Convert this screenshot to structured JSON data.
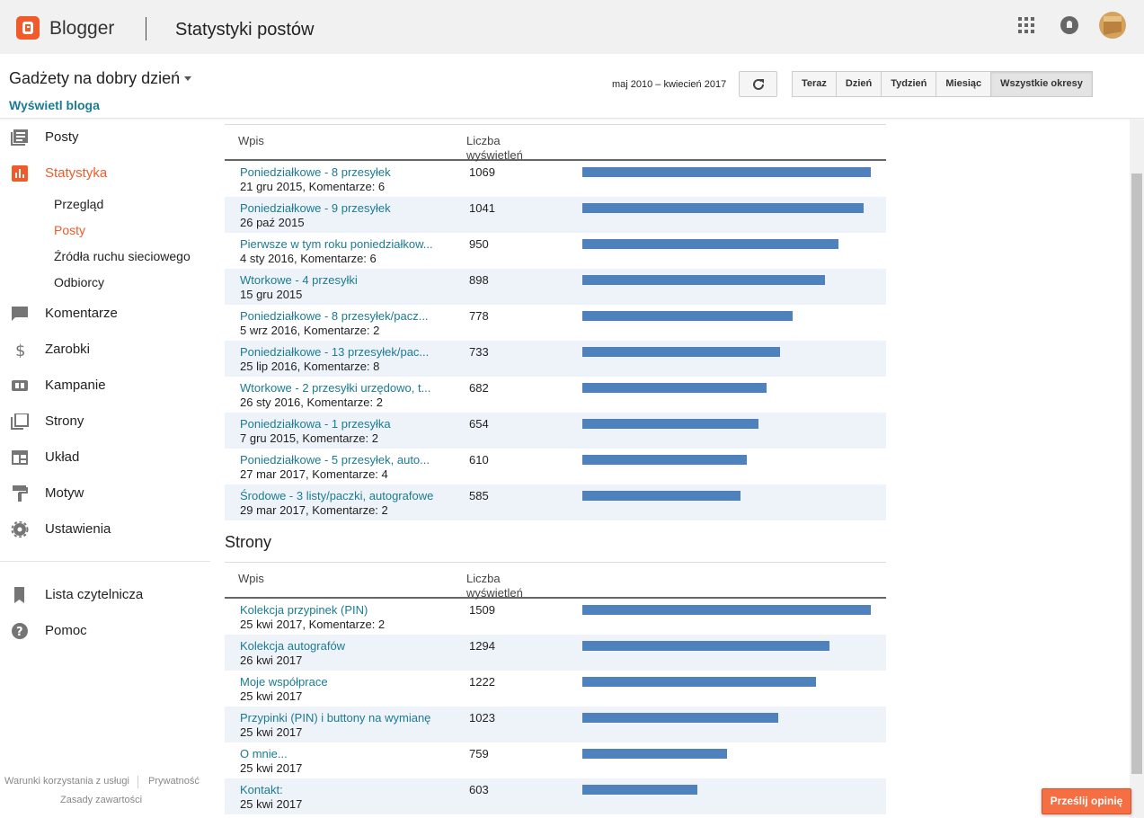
{
  "topbar": {
    "brand": "Blogger",
    "title": "Statystyki postów",
    "icons": [
      "apps-grid-icon",
      "notifications-bell-icon",
      "account-avatar"
    ]
  },
  "subheader": {
    "blog_name": "Gadżety na dobry dzień",
    "view_blog": "Wyświetl bloga",
    "date_range": "maj 2010 – kwiecień 2017",
    "periods": [
      "Teraz",
      "Dzień",
      "Tydzień",
      "Miesiąc",
      "Wszystkie okresy"
    ],
    "active_period": "Wszystkie okresy"
  },
  "sidebar": {
    "items": [
      {
        "label": "Posty",
        "icon": "posts-icon"
      },
      {
        "label": "Statystyka",
        "icon": "stats-icon",
        "active": true
      },
      {
        "label": "Komentarze",
        "icon": "comments-icon"
      },
      {
        "label": "Zarobki",
        "icon": "dollar-icon"
      },
      {
        "label": "Kampanie",
        "icon": "ad-campaign-icon"
      },
      {
        "label": "Strony",
        "icon": "pages-icon"
      },
      {
        "label": "Układ",
        "icon": "layout-icon"
      },
      {
        "label": "Motyw",
        "icon": "paint-roller-icon"
      },
      {
        "label": "Ustawienia",
        "icon": "gear-icon"
      }
    ],
    "sub_items": [
      {
        "label": "Przegląd"
      },
      {
        "label": "Posty",
        "active": true
      },
      {
        "label": "Źródła ruchu sieciowego"
      },
      {
        "label": "Odbiorcy"
      }
    ],
    "secondary": [
      {
        "label": "Lista czytelnicza",
        "icon": "bookmark-icon"
      },
      {
        "label": "Pomoc",
        "icon": "help-icon"
      }
    ],
    "footer": {
      "terms": "Warunki korzystania z usługi",
      "privacy": "Prywatność",
      "content_policy": "Zasady zawartości"
    }
  },
  "posts_table": {
    "col_entry": "Wpis",
    "col_views": "Liczba wyświetleń",
    "max": 1069,
    "rows": [
      {
        "title": "Poniedziałkowe - 8 przesyłek",
        "meta": "21 gru 2015, Komentarze: 6",
        "views": 1069
      },
      {
        "title": "Poniedziałkowe - 9 przesyłek",
        "meta": "26 paź 2015",
        "views": 1041
      },
      {
        "title": "Pierwsze w tym roku poniedziałkow...",
        "meta": "4 sty 2016, Komentarze: 6",
        "views": 950
      },
      {
        "title": "Wtorkowe - 4 przesyłki",
        "meta": "15 gru 2015",
        "views": 898
      },
      {
        "title": "Poniedziałkowe - 8 przesyłek/pacz...",
        "meta": "5 wrz 2016, Komentarze: 2",
        "views": 778
      },
      {
        "title": "Poniedziałkowe - 13 przesyłek/pac...",
        "meta": "25 lip 2016, Komentarze: 8",
        "views": 733
      },
      {
        "title": "Wtorkowe - 2 przesyłki urzędowo, t...",
        "meta": "26 sty 2016, Komentarze: 2",
        "views": 682
      },
      {
        "title": "Poniedziałkowa - 1 przesyłka",
        "meta": "7 gru 2015, Komentarze: 2",
        "views": 654
      },
      {
        "title": "Poniedziałkowe - 5 przesyłek, auto...",
        "meta": "27 mar 2017, Komentarze: 4",
        "views": 610
      },
      {
        "title": "Środowe - 3 listy/paczki, autografowe",
        "meta": "29 mar 2017, Komentarze: 2",
        "views": 585
      }
    ]
  },
  "pages_section": {
    "title": "Strony",
    "col_entry": "Wpis",
    "col_views": "Liczba wyświetleń",
    "max": 1509,
    "rows": [
      {
        "title": "Kolekcja przypinek (PIN)",
        "meta": "25 kwi 2017, Komentarze: 2",
        "views": 1509
      },
      {
        "title": "Kolekcja autografów",
        "meta": "26 kwi 2017",
        "views": 1294
      },
      {
        "title": "Moje współprace",
        "meta": "25 kwi 2017",
        "views": 1222
      },
      {
        "title": "Przypinki (PIN) i buttony na wymianę",
        "meta": "25 kwi 2017",
        "views": 1023
      },
      {
        "title": "O mnie...",
        "meta": "25 kwi 2017",
        "views": 759
      },
      {
        "title": "Kontakt:",
        "meta": "25 kwi 2017",
        "views": 603
      }
    ]
  },
  "feedback": {
    "label": "Prześlij opinię"
  },
  "colors": {
    "accent": "#f25a29",
    "link": "#1b7b91",
    "bar": "#4f81bd",
    "row_alt": "#eef3fa"
  }
}
